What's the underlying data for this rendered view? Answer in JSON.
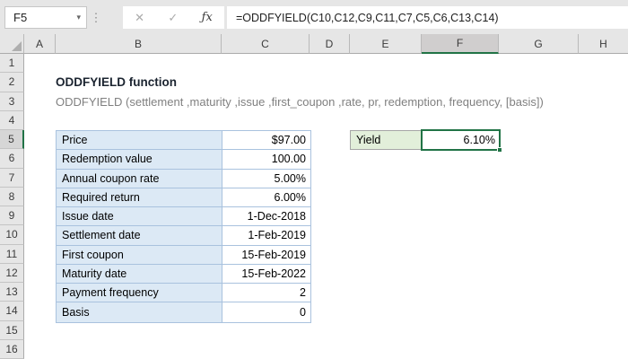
{
  "formula_bar": {
    "name_box_value": "F5",
    "dropdown_icon": "▾",
    "dots_icon": "⋮",
    "cancel_icon": "✕",
    "enter_icon": "✓",
    "fx_icon": "ƒx",
    "formula": "=ODDFYIELD(C10,C12,C9,C11,C7,C5,C6,C13,C14)"
  },
  "grid": {
    "column_letters": [
      "A",
      "B",
      "C",
      "D",
      "E",
      "F",
      "G",
      "H"
    ],
    "selected_column": "F",
    "row_numbers": [
      "1",
      "2",
      "3",
      "4",
      "5",
      "6",
      "7",
      "8",
      "9",
      "10",
      "11",
      "12",
      "13",
      "14",
      "15",
      "16"
    ],
    "selected_row": "5",
    "selected_cell": "F5"
  },
  "content": {
    "title": "ODDFYIELD function",
    "syntax": "ODDFYIELD (settlement ,maturity ,issue ,first_coupon ,rate, pr, redemption, frequency, [basis])",
    "table": {
      "rows": [
        {
          "label": "Price",
          "value": "$97.00"
        },
        {
          "label": "Redemption value",
          "value": "100.00"
        },
        {
          "label": "Annual coupon rate",
          "value": "5.00%"
        },
        {
          "label": "Required return",
          "value": "6.00%"
        },
        {
          "label": "Issue date",
          "value": "1-Dec-2018"
        },
        {
          "label": "Settlement date",
          "value": "1-Feb-2019"
        },
        {
          "label": "First coupon",
          "value": "15-Feb-2019"
        },
        {
          "label": "Maturity date",
          "value": "15-Feb-2022"
        },
        {
          "label": "Payment frequency",
          "value": "2"
        },
        {
          "label": "Basis",
          "value": "0"
        }
      ]
    },
    "result": {
      "label": "Yield",
      "value": "6.10%"
    }
  },
  "colors": {
    "selection_green": "#217346",
    "table_fill": "#DCE9F5",
    "table_border": "#A9C2DE",
    "result_fill": "#E2EFDA",
    "header_bg": "#E6E6E6",
    "header_selected_bg": "#D0CECE",
    "title_color": "#1B2430",
    "syntax_color": "#808080"
  }
}
